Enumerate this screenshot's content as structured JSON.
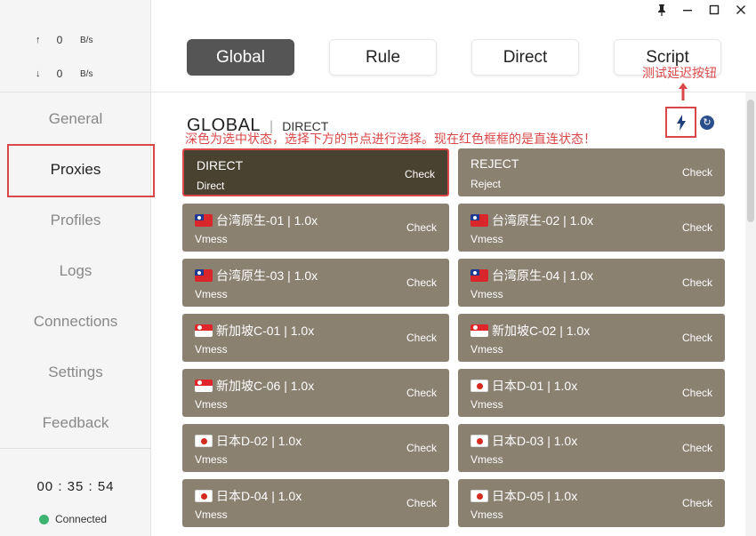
{
  "window": {
    "pin_glyph": "📌",
    "minimize_glyph": "—",
    "maximize_glyph": "☐",
    "close_glyph": "✕"
  },
  "traffic": {
    "up": {
      "arrow": "↑",
      "value": "0",
      "unit": "B/s"
    },
    "down": {
      "arrow": "↓",
      "value": "0",
      "unit": "B/s"
    }
  },
  "sidebar": {
    "items": [
      {
        "label": "General"
      },
      {
        "label": "Proxies"
      },
      {
        "label": "Profiles"
      },
      {
        "label": "Logs"
      },
      {
        "label": "Connections"
      },
      {
        "label": "Settings"
      },
      {
        "label": "Feedback"
      }
    ],
    "active": "Proxies"
  },
  "footer": {
    "clock": "00 : 35 : 54",
    "status": "Connected"
  },
  "modes": [
    "Global",
    "Rule",
    "Direct",
    "Script"
  ],
  "active_mode": "Global",
  "annotations": {
    "test_latency": "测试延迟按钮",
    "state_note": "深色为选中状态，选择下方的节点进行选择。现在红色框框的是直连状态！"
  },
  "group": {
    "name": "GLOBAL",
    "separator": "|",
    "current": "DIRECT"
  },
  "cards": [
    {
      "name": "DIRECT",
      "type": "Direct",
      "check": "Check",
      "flag": "",
      "selected": true
    },
    {
      "name": "REJECT",
      "type": "Reject",
      "check": "Check",
      "flag": ""
    },
    {
      "name": "台湾原生-01 | 1.0x",
      "type": "Vmess",
      "check": "Check",
      "flag": "tw"
    },
    {
      "name": "台湾原生-02 | 1.0x",
      "type": "Vmess",
      "check": "Check",
      "flag": "tw"
    },
    {
      "name": "台湾原生-03 | 1.0x",
      "type": "Vmess",
      "check": "Check",
      "flag": "tw"
    },
    {
      "name": "台湾原生-04 | 1.0x",
      "type": "Vmess",
      "check": "Check",
      "flag": "tw"
    },
    {
      "name": "新加坡C-01 | 1.0x",
      "type": "Vmess",
      "check": "Check",
      "flag": "sg"
    },
    {
      "name": "新加坡C-02 | 1.0x",
      "type": "Vmess",
      "check": "Check",
      "flag": "sg"
    },
    {
      "name": "新加坡C-06 | 1.0x",
      "type": "Vmess",
      "check": "Check",
      "flag": "sg"
    },
    {
      "name": "日本D-01 | 1.0x",
      "type": "Vmess",
      "check": "Check",
      "flag": "jp"
    },
    {
      "name": "日本D-02 | 1.0x",
      "type": "Vmess",
      "check": "Check",
      "flag": "jp"
    },
    {
      "name": "日本D-03 | 1.0x",
      "type": "Vmess",
      "check": "Check",
      "flag": "jp"
    },
    {
      "name": "日本D-04 | 1.0x",
      "type": "Vmess",
      "check": "Check",
      "flag": "jp"
    },
    {
      "name": "日本D-05 | 1.0x",
      "type": "Vmess",
      "check": "Check",
      "flag": "jp"
    }
  ],
  "colors": {
    "card": "#8a8171",
    "card_selected": "#4a4231",
    "annotation": "#d94848",
    "mode_active": "#555555",
    "connected": "#3cb371"
  }
}
